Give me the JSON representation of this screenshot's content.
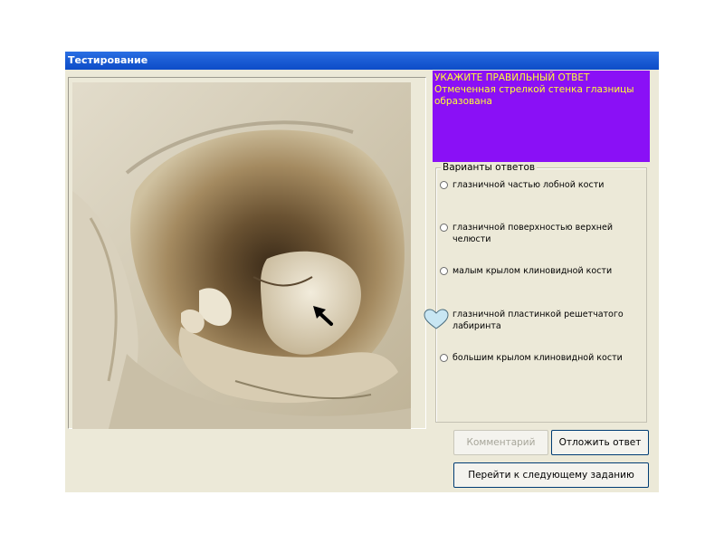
{
  "window": {
    "title": "Тестирование"
  },
  "question": {
    "heading": "УКАЖИТЕ ПРАВИЛЬНЫЙ ОТВЕТ",
    "text": "Отмеченная стрелкой стенка глазницы образована"
  },
  "answers": {
    "legend": "Варианты ответов",
    "options": [
      {
        "label": " глазничной частью лобной кости",
        "selected": false
      },
      {
        "label": "глазничной поверхностью верхней челюсти",
        "selected": false
      },
      {
        "label": "малым крылом клиновидной кости",
        "selected": false
      },
      {
        "label": "глазничной пластинкой решетчатого лабиринта",
        "selected": false
      },
      {
        "label": "большим крылом клиновидной кости",
        "selected": false
      }
    ]
  },
  "buttons": {
    "comment": "Комментарий",
    "postpone": "Отложить ответ",
    "next": "Перейти к следующему заданию"
  },
  "colors": {
    "title_bar": "#0d4cc8",
    "question_bg": "#8a10f6",
    "question_text": "#ffff33",
    "window_bg": "#ece9d8"
  },
  "icons": {
    "pointer": "heart-pointer-icon",
    "arrow": "arrow-icon"
  }
}
